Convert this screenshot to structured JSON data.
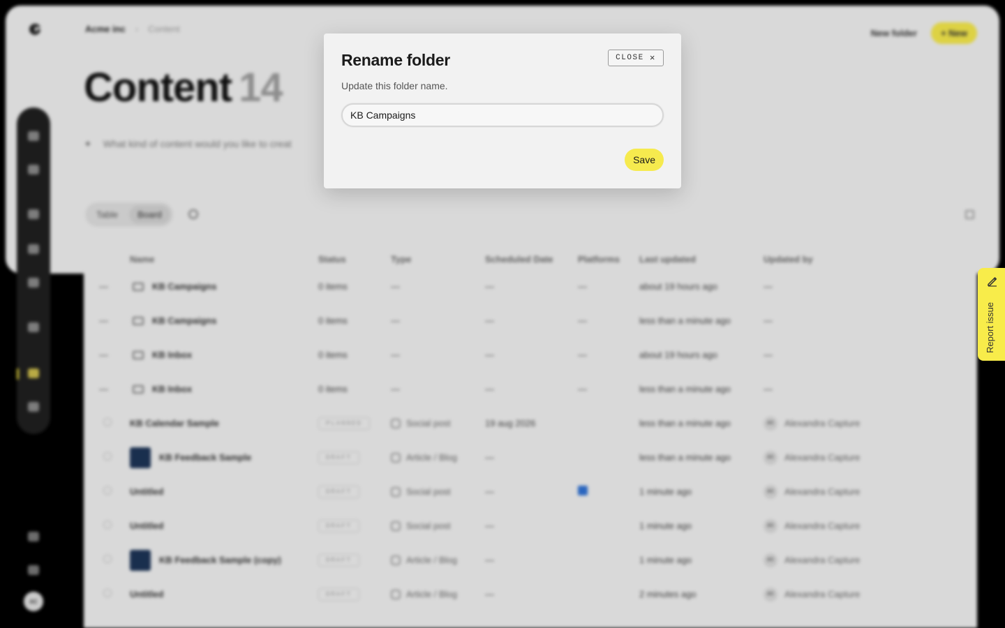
{
  "background": {
    "breadcrumb": {
      "org": "Acme inc",
      "separator": "›",
      "page": "Content"
    },
    "top_actions": {
      "new_folder": "New folder",
      "new_button": "+ New"
    },
    "title": {
      "text": "Content",
      "count": "14"
    },
    "prompt": {
      "icon": "sparkle-icon",
      "placeholder": "What kind of content would you like to creat"
    },
    "view_toggle": [
      "Table",
      "Board"
    ],
    "columns": [
      "Name",
      "Status",
      "Type",
      "Scheduled Date",
      "Platforms",
      "Last updated",
      "Updated by"
    ],
    "rows": [
      {
        "lead": "—",
        "kind": "folder",
        "name": "KB Campaigns",
        "status": "0 items",
        "type": "—",
        "scheduled": "—",
        "platforms": "—",
        "updated": "about 19 hours ago",
        "by": "—"
      },
      {
        "lead": "—",
        "kind": "folder",
        "name": "KB Campaigns",
        "status": "0 items",
        "type": "—",
        "scheduled": "—",
        "platforms": "—",
        "updated": "less than a minute ago",
        "by": "—"
      },
      {
        "lead": "—",
        "kind": "folder",
        "name": "KB Inbox",
        "status": "0 items",
        "type": "—",
        "scheduled": "—",
        "platforms": "—",
        "updated": "about 19 hours ago",
        "by": "—"
      },
      {
        "lead": "—",
        "kind": "folder",
        "name": "KB Inbox",
        "status": "0 items",
        "type": "—",
        "scheduled": "—",
        "platforms": "—",
        "updated": "less than a minute ago",
        "by": "—"
      },
      {
        "lead": "",
        "kind": "item",
        "name": "KB Calendar Sample",
        "status": "PLANNED",
        "type": "Social post",
        "scheduled": "19 aug 2026",
        "platforms": "",
        "updated": "less than a minute ago",
        "by": "Alexandra Capture"
      },
      {
        "lead": "",
        "kind": "thumb",
        "name": "KB Feedback Sample",
        "status": "DRAFT",
        "type": "Article / Blog",
        "scheduled": "—",
        "platforms": "",
        "updated": "less than a minute ago",
        "by": "Alexandra Capture"
      },
      {
        "lead": "",
        "kind": "item",
        "name": "Untitled",
        "status": "DRAFT",
        "type": "Social post",
        "scheduled": "—",
        "platforms": "icon",
        "updated": "1 minute ago",
        "by": "Alexandra Capture"
      },
      {
        "lead": "",
        "kind": "item",
        "name": "Untitled",
        "status": "DRAFT",
        "type": "Social post",
        "scheduled": "—",
        "platforms": "",
        "updated": "1 minute ago",
        "by": "Alexandra Capture"
      },
      {
        "lead": "",
        "kind": "thumb",
        "name": "KB Feedback Sample (copy)",
        "status": "DRAFT",
        "type": "Article / Blog",
        "scheduled": "—",
        "platforms": "",
        "updated": "1 minute ago",
        "by": "Alexandra Capture"
      },
      {
        "lead": "",
        "kind": "item",
        "name": "Untitled",
        "status": "DRAFT",
        "type": "Article / Blog",
        "scheduled": "—",
        "platforms": "",
        "updated": "2 minutes ago",
        "by": "Alexandra Capture"
      }
    ],
    "avatar_initials": "AC"
  },
  "modal": {
    "title": "Rename folder",
    "subtitle": "Update this folder name.",
    "close_label": "CLOSE",
    "close_icon": "×",
    "input_value": "KB Campaigns",
    "save_label": "Save"
  },
  "report_tab": {
    "label": "Report issue",
    "icon": "pencil-icon"
  },
  "colors": {
    "accent_yellow": "#f6ea4e",
    "modal_bg": "#f2f2f2",
    "panel_bg": "#ececec"
  }
}
